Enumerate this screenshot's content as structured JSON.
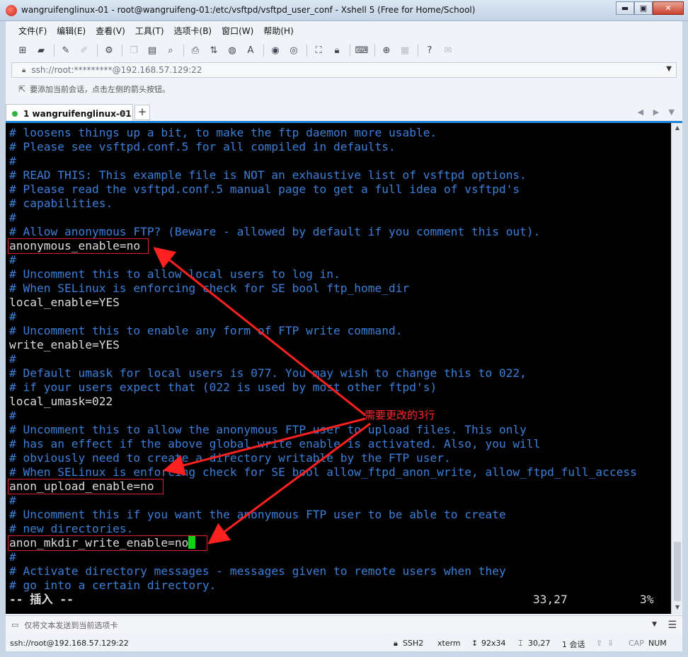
{
  "window": {
    "title": "wangruifenglinux-01 - root@wangruifeng-01:/etc/vsftpd/vsftpd_user_conf - Xshell 5 (Free for Home/School)",
    "minimize": "▬",
    "maximize": "▣",
    "close": "✕"
  },
  "menu": {
    "items": [
      {
        "label": "文件(F)"
      },
      {
        "label": "编辑(E)"
      },
      {
        "label": "查看(V)"
      },
      {
        "label": "工具(T)"
      },
      {
        "label": "选项卡(B)"
      },
      {
        "label": "窗口(W)"
      },
      {
        "label": "帮助(H)"
      }
    ]
  },
  "address": {
    "value": "ssh://root:*********@192.168.57.129:22"
  },
  "hint": {
    "text": "要添加当前会话，点击左侧的箭头按钮。"
  },
  "tabs": {
    "active_label": "1 wangruifenglinux-01",
    "close": "×",
    "add": "+",
    "nav": "◀ ▶ ▼"
  },
  "terminal": {
    "lines": [
      "# loosens things up a bit, to make the ftp daemon more usable.",
      "# Please see vsftpd.conf.5 for all compiled in defaults.",
      "#",
      "# READ THIS: This example file is NOT an exhaustive list of vsftpd options.",
      "# Please read the vsftpd.conf.5 manual page to get a full idea of vsftpd's",
      "# capabilities.",
      "#",
      "# Allow anonymous FTP? (Beware - allowed by default if you comment this out).",
      "anonymous_enable=no",
      "#",
      "# Uncomment this to allow local users to log in.",
      "# When SELinux is enforcing check for SE bool ftp_home_dir",
      "local_enable=YES",
      "#",
      "# Uncomment this to enable any form of FTP write command.",
      "write_enable=YES",
      "#",
      "# Default umask for local users is 077. You may wish to change this to 022,",
      "# if your users expect that (022 is used by most other ftpd's)",
      "local_umask=022",
      "#",
      "# Uncomment this to allow the anonymous FTP user to upload files. This only",
      "# has an effect if the above global write enable is activated. Also, you will",
      "# obviously need to create a directory writable by the FTP user.",
      "# When SELinux is enforcing check for SE bool allow_ftpd_anon_write, allow_ftpd_full_access",
      "anon_upload_enable=no",
      "#",
      "# Uncomment this if you want the anonymous FTP user to be able to create",
      "# new directories.",
      "anon_mkdir_write_enable=no",
      "#",
      "# Activate directory messages - messages given to remote users when they",
      "# go into a certain directory."
    ],
    "mode": "-- 插入 --",
    "position": "33,27",
    "percent": "3%",
    "annotation": "需要更改的3行"
  },
  "sendbar": {
    "placeholder": "仅将文本发送到当前选项卡"
  },
  "status": {
    "connection": "ssh://root@192.168.57.129:22",
    "protocol": "SSH2",
    "terminal_type": "xterm",
    "size": "92x34",
    "cursor": "30,27",
    "sessions": "1 会话",
    "caps": "CAP",
    "num": "NUM"
  },
  "colors": {
    "terminal_bg": "#000000",
    "comment_text": "#3c7fd8",
    "setting_text": "#dcdcdc",
    "cursor": "#19d019",
    "annotation": "#ff2a2a",
    "tab_accent": "#1b82d6"
  }
}
